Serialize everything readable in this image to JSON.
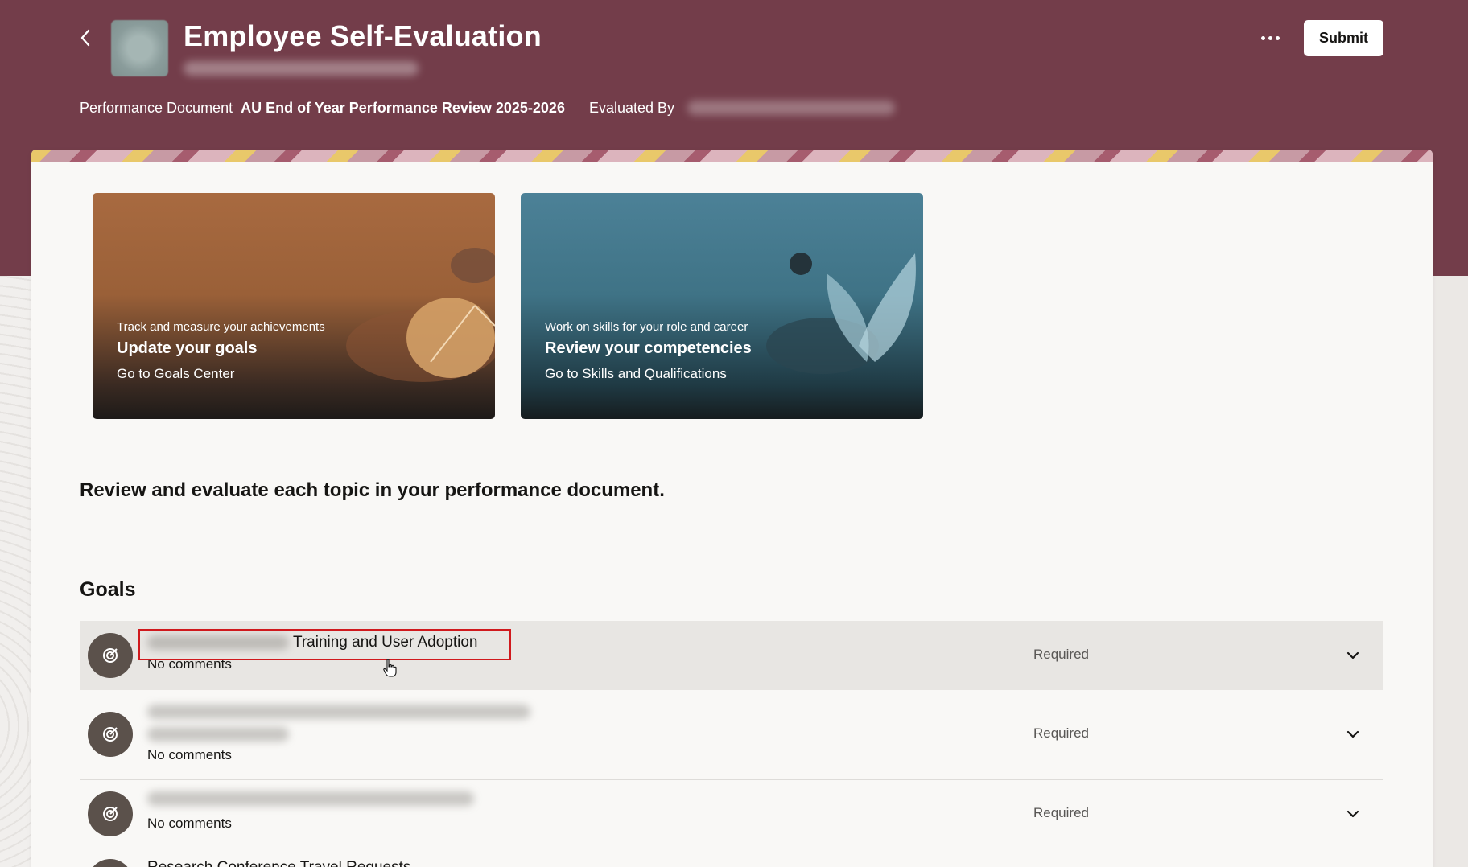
{
  "header": {
    "title": "Employee Self-Evaluation",
    "performance_document_label": "Performance Document",
    "performance_document_value": "AU End of Year Performance Review 2025-2026",
    "evaluated_by_label": "Evaluated By",
    "submit_label": "Submit",
    "back_icon": "chevron-left-icon",
    "more_icon": "more-horizontal-icon"
  },
  "promos": [
    {
      "eyebrow": "Track and measure your achievements",
      "title": "Update your goals",
      "link": "Go to Goals Center"
    },
    {
      "eyebrow": "Work on skills for your role and career",
      "title": "Review your competencies",
      "link": "Go to Skills and Qualifications"
    }
  ],
  "instructions": "Review and evaluate each topic in your performance document.",
  "goals": {
    "section_title": "Goals",
    "items": [
      {
        "name_visible": "Training and User Adoption",
        "comments": "No comments",
        "status": "Required"
      },
      {
        "comments": "No comments",
        "status": "Required"
      },
      {
        "comments": "No comments",
        "status": "Required"
      },
      {
        "name_visible": "Research Conference Travel Requests"
      }
    ]
  },
  "colors": {
    "header_bg": "#733d4a",
    "card_bg": "#f9f8f6",
    "active_row_bg": "#e8e6e3",
    "highlight": "#d0191d"
  }
}
